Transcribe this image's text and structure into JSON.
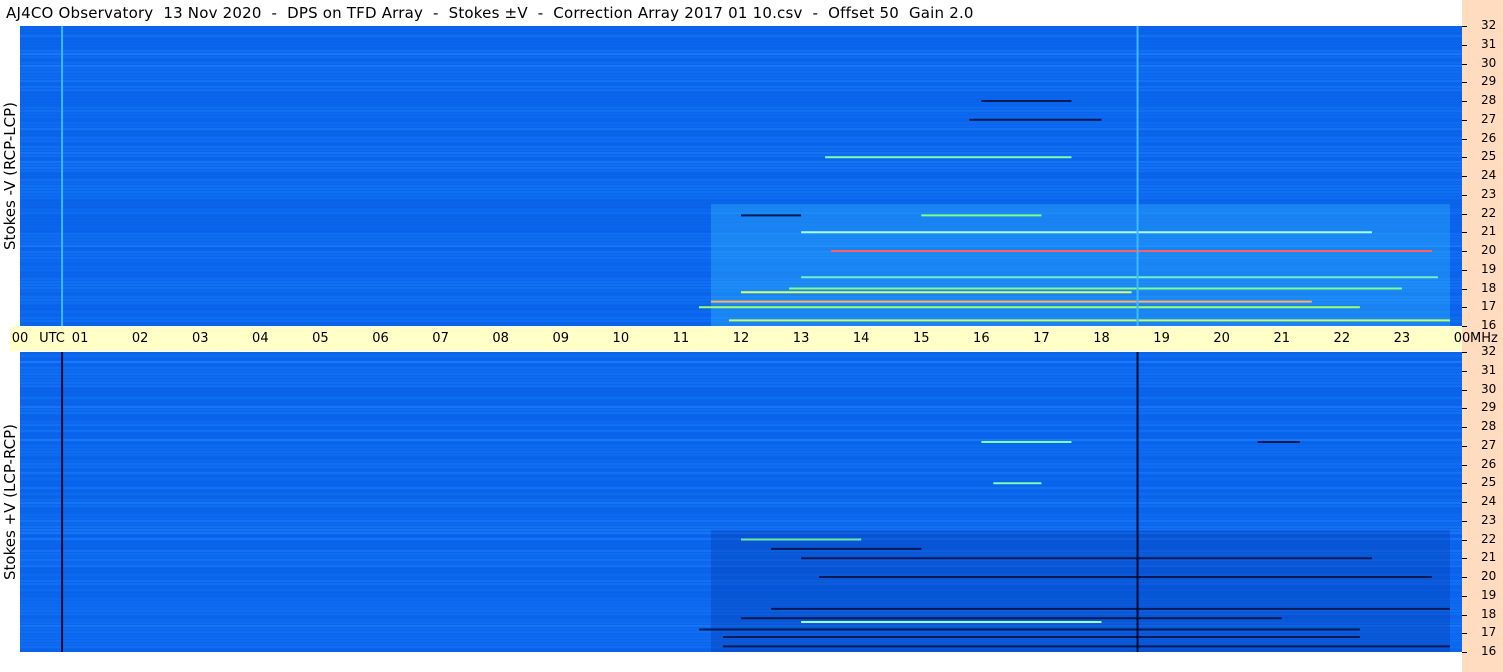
{
  "title": "AJ4CO Observatory  13 Nov 2020  -  DPS on TFD Array  -  Stokes ±V  -  Correction Array 2017 01 10.csv  -  Offset 50  Gain 2.0",
  "colors": {
    "background": "#0a66ee",
    "timebar": "#ffffc8",
    "rightbar": "#ffdcc0"
  },
  "chart_data": [
    {
      "type": "heatmap",
      "panel": "top",
      "ylabel": "Stokes -V (RCP-LCP)",
      "x_label": "UTC",
      "x_ticks": [
        "00",
        "01",
        "02",
        "03",
        "04",
        "05",
        "06",
        "07",
        "08",
        "09",
        "10",
        "11",
        "12",
        "13",
        "14",
        "15",
        "16",
        "17",
        "18",
        "19",
        "20",
        "21",
        "22",
        "23",
        "00"
      ],
      "xlim": [
        0,
        24
      ],
      "y_unit": "MHz",
      "y_ticks": [
        "32",
        "31",
        "30",
        "29",
        "28",
        "27",
        "26",
        "25",
        "24",
        "23",
        "22",
        "21",
        "20",
        "19",
        "18",
        "17",
        "16"
      ],
      "ylim": [
        16,
        32
      ],
      "vertical_lines_utc": [
        0.7,
        18.6
      ],
      "vertical_line_color": "#3fb8ff",
      "bright_lines": [
        {
          "f": 17.0,
          "t0": 11.3,
          "t1": 22.3,
          "color": "#9eff6a"
        },
        {
          "f": 17.3,
          "t0": 11.5,
          "t1": 21.5,
          "color": "#ffb060"
        },
        {
          "f": 17.8,
          "t0": 12.0,
          "t1": 18.5,
          "color": "#d8ff6a"
        },
        {
          "f": 18.0,
          "t0": 12.8,
          "t1": 23.0,
          "color": "#7dff8a"
        },
        {
          "f": 18.6,
          "t0": 13.0,
          "t1": 23.6,
          "color": "#6ff0c8"
        },
        {
          "f": 20.0,
          "t0": 13.5,
          "t1": 23.5,
          "color": "#ff6060"
        },
        {
          "f": 21.0,
          "t0": 13.0,
          "t1": 22.5,
          "color": "#aaffff"
        },
        {
          "f": 21.9,
          "t0": 15.0,
          "t1": 17.0,
          "color": "#7dff8a"
        },
        {
          "f": 25.0,
          "t0": 13.4,
          "t1": 17.5,
          "color": "#7dffb0"
        },
        {
          "f": 16.3,
          "t0": 11.8,
          "t1": 23.8,
          "color": "#c0ff6a"
        }
      ],
      "dark_lines": [
        {
          "f": 21.9,
          "t0": 12.0,
          "t1": 13.0
        },
        {
          "f": 27.0,
          "t0": 15.8,
          "t1": 18.0
        },
        {
          "f": 28.0,
          "t0": 16.0,
          "t1": 17.5
        }
      ]
    },
    {
      "type": "heatmap",
      "panel": "bottom",
      "ylabel": "Stokes +V (LCP-RCP)",
      "x_label": "UTC",
      "x_ticks": [
        "00",
        "01",
        "02",
        "03",
        "04",
        "05",
        "06",
        "07",
        "08",
        "09",
        "10",
        "11",
        "12",
        "13",
        "14",
        "15",
        "16",
        "17",
        "18",
        "19",
        "20",
        "21",
        "22",
        "23",
        "00"
      ],
      "xlim": [
        0,
        24
      ],
      "y_unit": "MHz",
      "y_ticks": [
        "32",
        "31",
        "30",
        "29",
        "28",
        "27",
        "26",
        "25",
        "24",
        "23",
        "22",
        "21",
        "20",
        "19",
        "18",
        "17",
        "16"
      ],
      "ylim": [
        16,
        32
      ],
      "vertical_lines_utc": [
        0.7,
        18.6
      ],
      "vertical_line_color": "#000830",
      "bright_lines": [
        {
          "f": 22.0,
          "t0": 12.0,
          "t1": 14.0,
          "color": "#6fe6a0"
        },
        {
          "f": 17.6,
          "t0": 13.0,
          "t1": 18.0,
          "color": "#a0ffd0"
        },
        {
          "f": 25.0,
          "t0": 16.2,
          "t1": 17.0,
          "color": "#7dffb0"
        },
        {
          "f": 27.2,
          "t0": 16.0,
          "t1": 17.5,
          "color": "#7dffb0"
        }
      ],
      "dark_lines": [
        {
          "f": 16.3,
          "t0": 11.7,
          "t1": 23.8
        },
        {
          "f": 16.8,
          "t0": 11.7,
          "t1": 22.3
        },
        {
          "f": 17.2,
          "t0": 11.3,
          "t1": 22.3
        },
        {
          "f": 17.8,
          "t0": 12.0,
          "t1": 21.0
        },
        {
          "f": 18.3,
          "t0": 12.5,
          "t1": 23.8
        },
        {
          "f": 20.0,
          "t0": 13.3,
          "t1": 23.5
        },
        {
          "f": 21.0,
          "t0": 13.0,
          "t1": 22.5
        },
        {
          "f": 21.5,
          "t0": 12.5,
          "t1": 15.0
        },
        {
          "f": 27.2,
          "t0": 20.6,
          "t1": 21.3
        }
      ]
    }
  ]
}
